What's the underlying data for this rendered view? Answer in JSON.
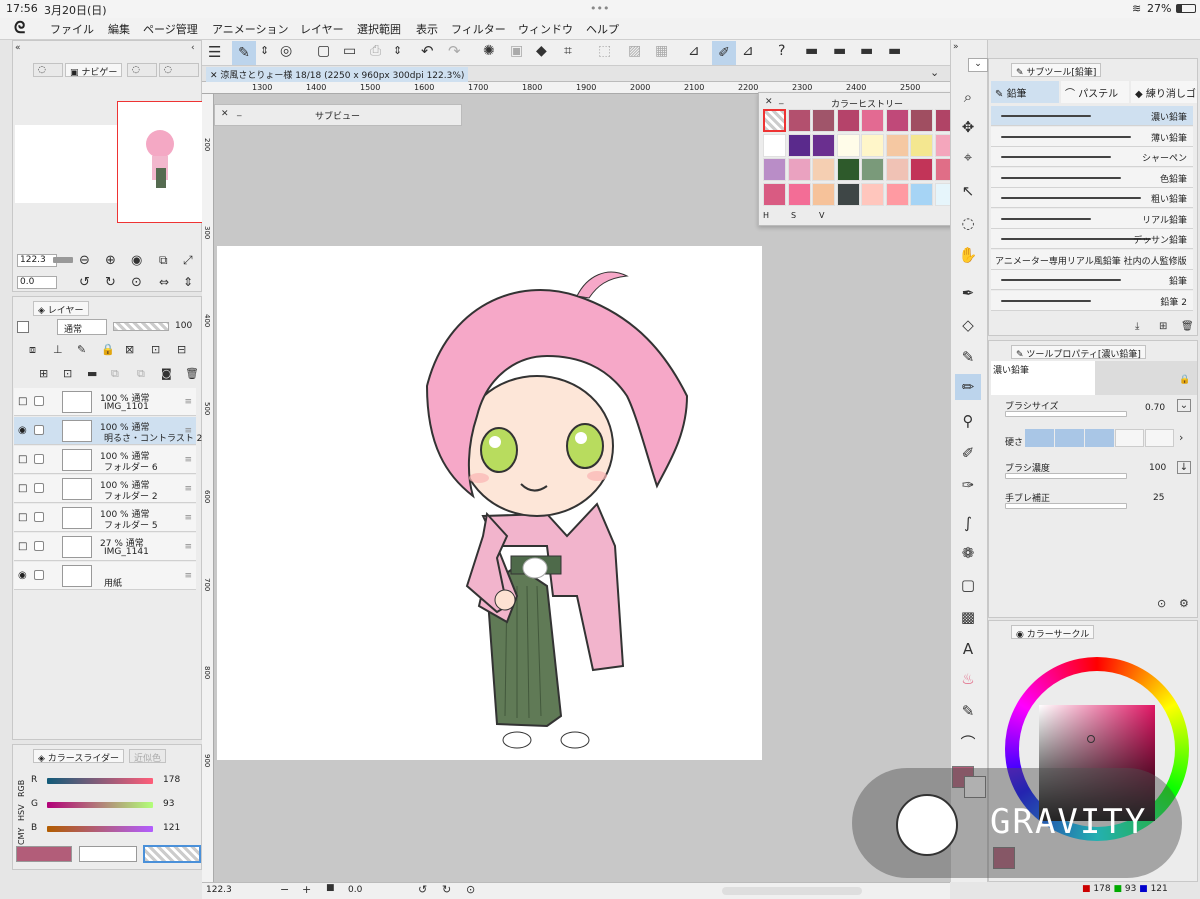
{
  "status": {
    "time": "17:56",
    "date": "3月20日(日)",
    "dots": "•••",
    "battery": "27%"
  },
  "menu": {
    "items": [
      "ファイル",
      "編集",
      "ページ管理",
      "アニメーション",
      "レイヤー",
      "選択範囲",
      "表示",
      "フィルター",
      "ウィンドウ",
      "ヘルプ"
    ]
  },
  "navigator": {
    "tabs": [
      "ナビゲー"
    ],
    "zoom": "122.3",
    "rotate": "0.0"
  },
  "document": {
    "title": "涼風さとりょー様 18/18 (2250 x 960px 300dpi 122.3%)",
    "ruler_h": [
      "1300",
      "1400",
      "1500",
      "1600",
      "1700",
      "1800",
      "1900",
      "2000",
      "2100",
      "2200",
      "2300",
      "2400",
      "2500"
    ],
    "ruler_v": [
      "200",
      "300",
      "400",
      "500",
      "600",
      "700",
      "800",
      "900"
    ]
  },
  "subview": {
    "title": "サブビュー"
  },
  "color_history": {
    "title": "カラーヒストリー",
    "footer": [
      "H",
      "S",
      "V"
    ],
    "colors": [
      "checker",
      "#b3506e",
      "#a0556a",
      "#b5436a",
      "#e36a92",
      "#c04979",
      "#a04e61",
      "#b04466",
      "#ffffff",
      "#5a2a8c",
      "#6a2f8f",
      "#fffce9",
      "#fff6c9",
      "#f5c8a2",
      "#f4e790",
      "#f4a6bc",
      "#b98dc7",
      "#eaa2c0",
      "#f5cfb2",
      "#2e5a2b",
      "#7a9a7a",
      "#f0c2b5",
      "#c23458",
      "#e06e87",
      "#d95b82",
      "#f36d96",
      "#f6c29a",
      "#3e4646",
      "#ffc6bd",
      "#ff9aa2",
      "#a6d4f5",
      "#e6f5fb"
    ]
  },
  "layers": {
    "tab": "レイヤー",
    "blend": "通常",
    "opacity": "100",
    "rows": [
      {
        "l1": "100 % 通常",
        "l2": "IMG_1101",
        "sel": false,
        "eye": false
      },
      {
        "l1": "100 % 通常",
        "l2": "明るさ・コントラスト 2",
        "sel": true,
        "eye": true
      },
      {
        "l1": "100 % 通常",
        "l2": "フォルダー 6",
        "sel": false,
        "eye": false
      },
      {
        "l1": "100 % 通常",
        "l2": "フォルダー 2",
        "sel": false,
        "eye": false
      },
      {
        "l1": "100 % 通常",
        "l2": "フォルダー 5",
        "sel": false,
        "eye": false
      },
      {
        "l1": "27 % 通常",
        "l2": "IMG_1141",
        "sel": false,
        "eye": false
      },
      {
        "l1": "",
        "l2": "用紙",
        "sel": false,
        "eye": true
      }
    ]
  },
  "color_slider": {
    "tabs": [
      "カラースライダー",
      "近似色"
    ],
    "modes": [
      "RGB",
      "HSV",
      "CMY"
    ],
    "labels": [
      "R",
      "G",
      "B"
    ],
    "values": [
      "178",
      "93",
      "121"
    ]
  },
  "subtool": {
    "tab": "サブツール[鉛筆]",
    "groups": [
      "鉛筆",
      "パステル",
      "練り消しゴ"
    ],
    "brushes": [
      "濃い鉛筆",
      "薄い鉛筆",
      "シャーペン",
      "色鉛筆",
      "粗い鉛筆",
      "リアル鉛筆",
      "デッサン鉛筆",
      "アニメーター専用リアル風鉛筆 社内の人監修版",
      "鉛筆",
      "鉛筆 2"
    ]
  },
  "tool_property": {
    "tab": "ツールプロパティ[濃い鉛筆]",
    "tool": "濃い鉛筆",
    "props": [
      {
        "label": "ブラシサイズ",
        "value": "0.70"
      },
      {
        "label": "硬さ",
        "value": ""
      },
      {
        "label": "ブラシ濃度",
        "value": "100"
      },
      {
        "label": "手ブレ補正",
        "value": "25"
      }
    ]
  },
  "color_circle": {
    "tab": "カラーサークル",
    "main_color": "#b25d79",
    "rgb": [
      "178",
      "93",
      "121"
    ]
  },
  "watermark": {
    "text": "GRAVITY"
  },
  "bottom": {
    "zoom": "122.3",
    "rotate": "0.0"
  },
  "colors": {
    "accent": "#4a90d9",
    "select": "#cfe0f0",
    "main": "#b25d79"
  }
}
